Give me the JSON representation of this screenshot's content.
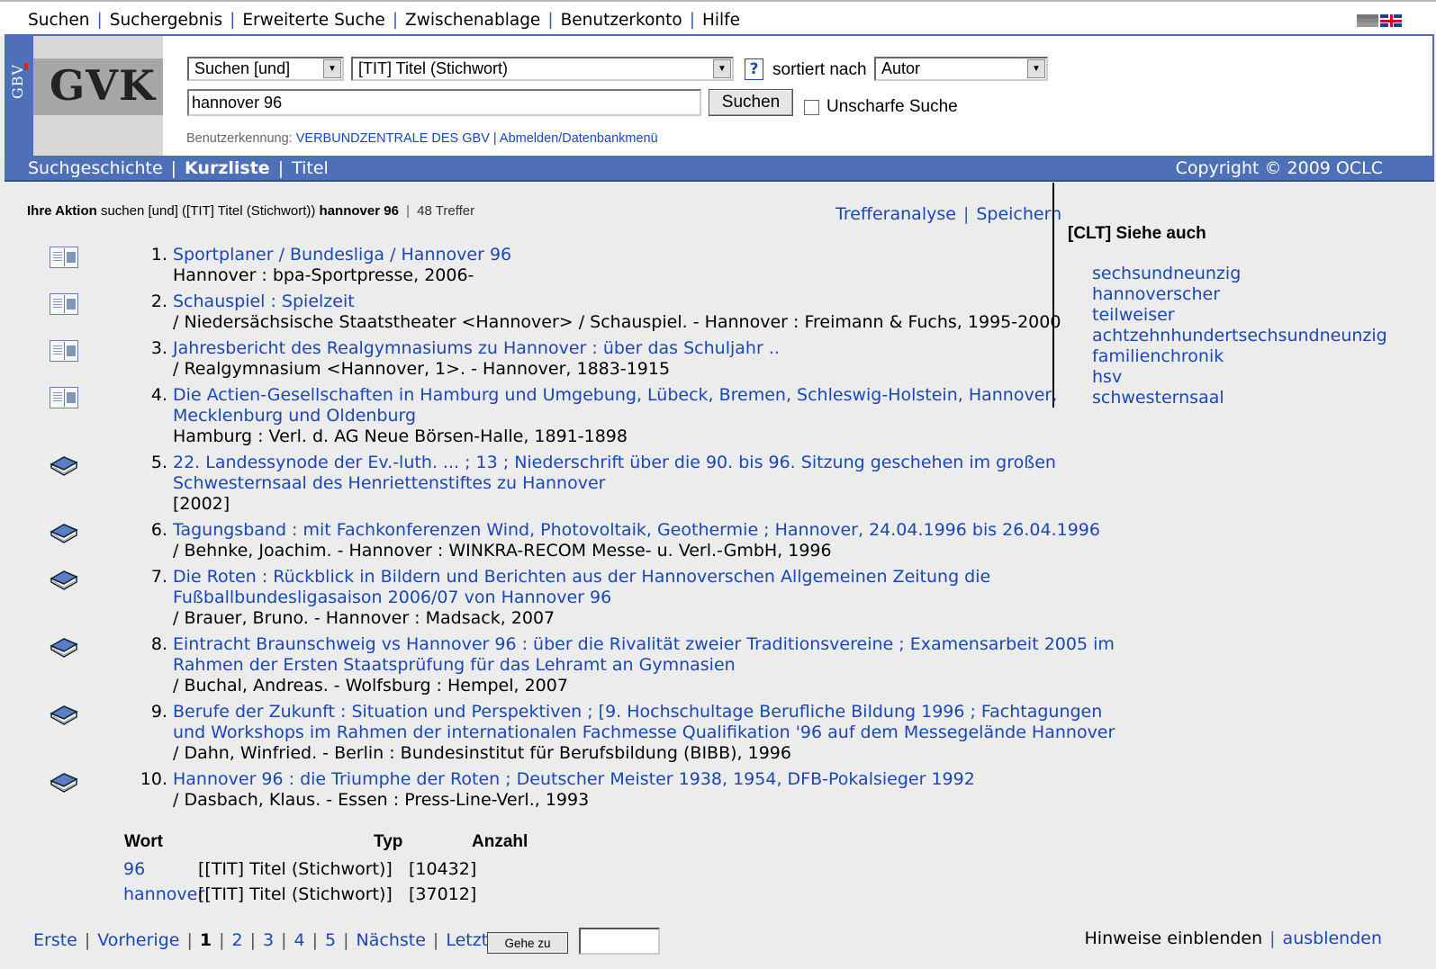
{
  "topnav": {
    "items": [
      "Suchen",
      "Suchergebnis",
      "Erweiterte Suche",
      "Zwischenablage",
      "Benutzerkonto",
      "Hilfe"
    ]
  },
  "logo": {
    "side": "GBV",
    "main": "GVK"
  },
  "search": {
    "mode_value": "Suchen [und]",
    "field_value": "[TIT] Titel (Stichwort)",
    "help_label": "?",
    "sort_label": "sortiert nach",
    "sort_value": "Autor",
    "query": "hannover 96",
    "submit_label": "Suchen",
    "fuzzy_label": "Unscharfe Suche"
  },
  "user": {
    "label": "Benutzerkennung:",
    "name": "VERBUNDZENTRALE DES GBV",
    "logout": "Abmelden/Datenbankmenü"
  },
  "bluebar": {
    "history": "Suchgeschichte",
    "shortlist": "Kurzliste",
    "title": "Titel",
    "copyright": "Copyright © 2009 OCLC"
  },
  "action": {
    "label": "Ihre Aktion",
    "text": "suchen [und] ([TIT] Titel (Stichwort))",
    "query": "hannover 96",
    "hits": "48 Treffer"
  },
  "tools": {
    "analysis": "Trefferanalyse",
    "save": "Speichern"
  },
  "results": [
    {
      "num": "1.",
      "type": "journal",
      "title": [
        "Sportplaner / Bundesliga / Hannover 96"
      ],
      "info": [
        "Hannover : bpa-Sportpresse, 2006-"
      ]
    },
    {
      "num": "2.",
      "type": "journal",
      "title": [
        "Schauspiel : Spielzeit"
      ],
      "info": [
        "/ Niedersächsische Staatstheater <Hannover> / Schauspiel. - Hannover : Freimann & Fuchs, 1995-2000"
      ]
    },
    {
      "num": "3.",
      "type": "journal",
      "title": [
        "Jahresbericht des Realgymnasiums zu Hannover : über das Schuljahr .."
      ],
      "info": [
        "/ Realgymnasium <Hannover, 1>. - Hannover, 1883-1915"
      ]
    },
    {
      "num": "4.",
      "type": "journal",
      "title": [
        "Die Actien-Gesellschaften in Hamburg und Umgebung, Lübeck, Bremen, Schleswig-Holstein, Hannover,",
        "Mecklenburg und Oldenburg"
      ],
      "info": [
        "Hamburg : Verl. d. AG Neue Börsen-Halle, 1891-1898"
      ]
    },
    {
      "num": "5.",
      "type": "book",
      "title": [
        "22. Landessynode der Ev.-luth. ... ; 13 ; Niederschrift über die 90. bis 96. Sitzung geschehen im großen",
        "Schwesternsaal des Henriettenstiftes zu Hannover"
      ],
      "info": [
        "[2002]"
      ]
    },
    {
      "num": "6.",
      "type": "book",
      "title": [
        "Tagungsband : mit Fachkonferenzen Wind, Photovoltaik, Geothermie ; Hannover, 24.04.1996 bis 26.04.1996"
      ],
      "info": [
        "/ Behnke, Joachim. - Hannover : WINKRA-RECOM Messe- u. Verl.-GmbH, 1996"
      ]
    },
    {
      "num": "7.",
      "type": "book",
      "title": [
        "Die Roten : Rückblick in Bildern und Berichten aus der Hannoverschen Allgemeinen Zeitung die",
        "Fußballbundesligasaison 2006/07 von Hannover 96"
      ],
      "info": [
        "/ Brauer, Bruno. - Hannover : Madsack, 2007"
      ]
    },
    {
      "num": "8.",
      "type": "book",
      "title": [
        "Eintracht Braunschweig vs Hannover 96 : über die Rivalität zweier Traditionsvereine ; Examensarbeit 2005 im",
        "Rahmen der Ersten Staatsprüfung für das Lehramt an Gymnasien"
      ],
      "info": [
        "/ Buchal, Andreas. - Wolfsburg : Hempel, 2007"
      ]
    },
    {
      "num": "9.",
      "type": "book",
      "title": [
        "Berufe der Zukunft : Situation und Perspektiven ; [9. Hochschultage Berufliche Bildung 1996 ; Fachtagungen",
        "und Workshops im Rahmen der internationalen Fachmesse Qualifikation '96 auf dem Messegelände Hannover"
      ],
      "info": [
        "/ Dahn, Winfried. - Berlin : Bundesinstitut für Berufsbildung (BIBB), 1996"
      ]
    },
    {
      "num": "10.",
      "type": "book",
      "title": [
        "Hannover 96 : die Triumphe der Roten ; Deutscher Meister 1938, 1954, DFB-Pokalsieger 1992"
      ],
      "info": [
        "/ Dasbach, Klaus. - Essen : Press-Line-Verl., 1993"
      ]
    }
  ],
  "siehe": {
    "title": "[CLT] Siehe auch",
    "items": [
      "sechsundneunzig",
      "hannoverscher",
      "teilweiser",
      "achtzehnhundertsechsundneunzig",
      "familienchronik",
      "hsv",
      "schwesternsaal"
    ]
  },
  "words": {
    "headers": {
      "wort": "Wort",
      "typ": "Typ",
      "anzahl": "Anzahl"
    },
    "rows": [
      {
        "wort": "96",
        "typ": "[[TIT] Titel (Stichwort)]",
        "anzahl": "[10432]"
      },
      {
        "wort": "hannover",
        "typ": "[[TIT] Titel (Stichwort)]",
        "anzahl": "[37012]"
      }
    ]
  },
  "pager": {
    "first": "Erste",
    "prev": "Vorherige",
    "pages": [
      "1",
      "2",
      "3",
      "4",
      "5"
    ],
    "next": "Nächste",
    "last": "Letzte",
    "goto": "Gehe zu"
  },
  "hints": {
    "show": "Hinweise einblenden",
    "hide": "ausblenden"
  }
}
